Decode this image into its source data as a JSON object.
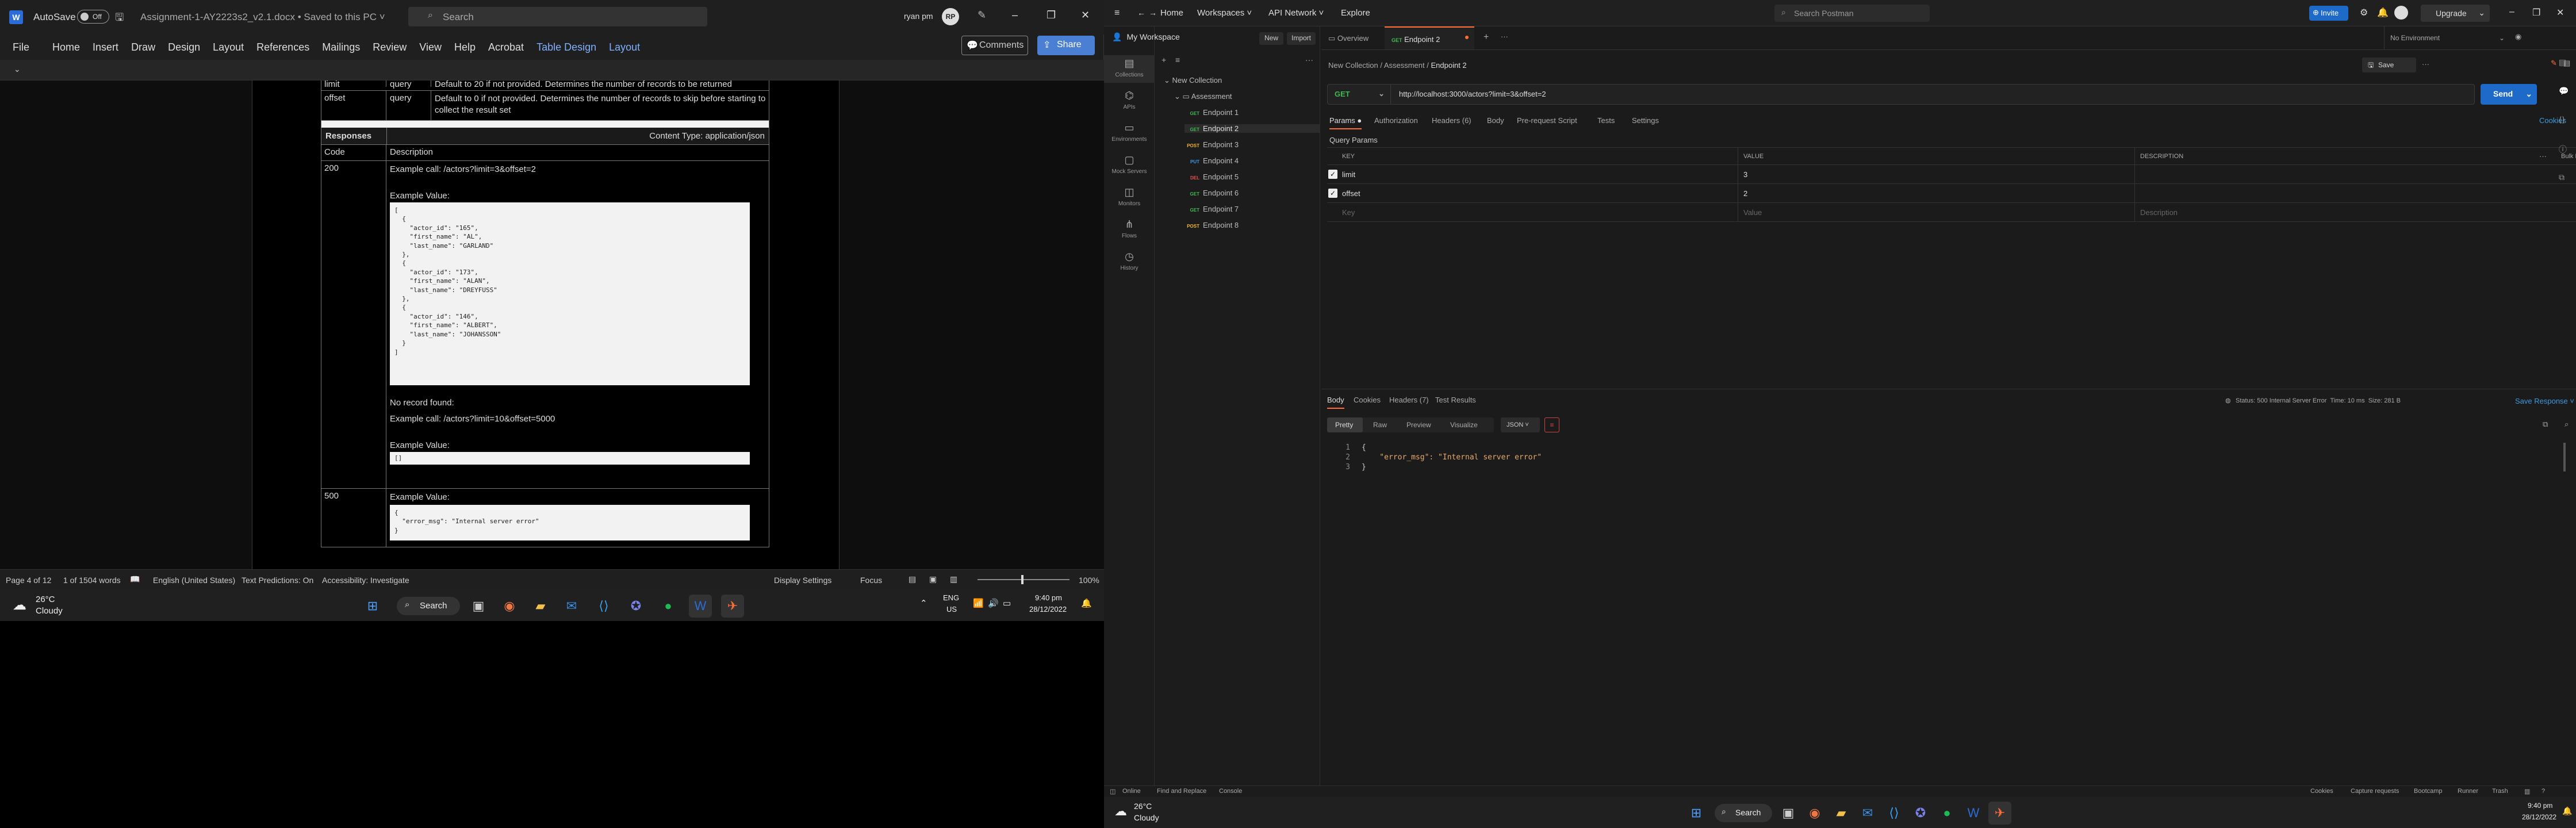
{
  "word": {
    "autosave": "AutoSave",
    "autosave_state": "Off",
    "doc_title": "Assignment-1-AY2223s2_v2.1.docx • Saved to this PC ˅",
    "search_placeholder": "Search",
    "user": "ryan pm",
    "avatar_initials": "RP",
    "menu": [
      "File",
      "Home",
      "Insert",
      "Draw",
      "Design",
      "Layout",
      "References",
      "Mailings",
      "Review",
      "View",
      "Help",
      "Acrobat",
      "Table Design",
      "Layout"
    ],
    "comments": "Comments",
    "share": "Share",
    "table": {
      "rows_top": [
        {
          "name": "limit",
          "type": "query",
          "desc": "Default to 20 if not provided. Determines the number of records to be returned"
        },
        {
          "name": "offset",
          "type": "query",
          "desc": "Default to 0 if not provided. Determines the number of records to skip before starting to collect the result set"
        }
      ],
      "responses_label": "Responses",
      "content_type": "Content Type: application/json",
      "col_code": "Code",
      "col_desc": "Description",
      "r200_code": "200",
      "r200_call": "Example call: /actors?limit=3&offset=2",
      "example_value": "Example Value:",
      "r200_json": "[\n  {\n    \"actor_id\": \"165\",\n    \"first_name\": \"AL\",\n    \"last_name\": \"GARLAND\"\n  },\n  {\n    \"actor_id\": \"173\",\n    \"first_name\": \"ALAN\",\n    \"last_name\": \"DREYFUSS\"\n  },\n  {\n    \"actor_id\": \"146\",\n    \"first_name\": \"ALBERT\",\n    \"last_name\": \"JOHANSSON\"\n  }\n]",
      "no_record": "No record found:",
      "r200_call2": "Example call: /actors?limit=10&offset=5000",
      "empty_json": "[]",
      "r500_code": "500",
      "r500_json": "{\n  \"error_msg\": \"Internal server error\"\n}"
    },
    "status": {
      "page": "Page 4 of 12",
      "words": "1 of 1504 words",
      "lang": "English (United States)",
      "predict": "Text Predictions: On",
      "access": "Accessibility: Investigate",
      "display": "Display Settings",
      "focus": "Focus",
      "zoom": "100%"
    },
    "taskbar": {
      "temp": "26°C",
      "weather": "Cloudy",
      "search": "Search",
      "lang1": "ENG",
      "lang2": "US",
      "time": "9:40 pm",
      "date": "28/12/2022"
    }
  },
  "postman": {
    "nav": [
      "Home",
      "Workspaces ˅",
      "API Network ˅",
      "Explore"
    ],
    "search": "Search Postman",
    "invite": "Invite",
    "upgrade": "Upgrade",
    "workspace": "My Workspace",
    "new_btn": "New",
    "import_btn": "Import",
    "rail": [
      "Collections",
      "APIs",
      "Environments",
      "Mock Servers",
      "Monitors",
      "Flows",
      "History"
    ],
    "collection": "New Collection",
    "folder": "Assessment",
    "endpoints": [
      {
        "m": "GET",
        "name": "Endpoint 1"
      },
      {
        "m": "GET",
        "name": "Endpoint 2"
      },
      {
        "m": "POST",
        "name": "Endpoint 3"
      },
      {
        "m": "PUT",
        "name": "Endpoint 4"
      },
      {
        "m": "DEL",
        "name": "Endpoint 5"
      },
      {
        "m": "GET",
        "name": "Endpoint 6"
      },
      {
        "m": "GET",
        "name": "Endpoint 7"
      },
      {
        "m": "POST",
        "name": "Endpoint 8"
      }
    ],
    "tab_overview": "Overview",
    "tab_active_method": "GET",
    "tab_active": "Endpoint 2",
    "no_env": "No Environment",
    "breadcrumb": [
      "New Collection",
      "Assessment",
      "Endpoint 2"
    ],
    "save": "Save",
    "method": "GET",
    "url": "http://localhost:3000/actors?limit=3&offset=2",
    "send": "Send",
    "req_tabs": [
      "Params ●",
      "Authorization",
      "Headers (6)",
      "Body",
      "Pre-request Script",
      "Tests",
      "Settings"
    ],
    "cookies": "Cookies",
    "query_params": "Query Params",
    "col_key": "KEY",
    "col_value": "VALUE",
    "col_desc": "DESCRIPTION",
    "bulk_edit": "Bulk Edit",
    "params": [
      {
        "key": "limit",
        "value": "3"
      },
      {
        "key": "offset",
        "value": "2"
      }
    ],
    "ph_key": "Key",
    "ph_value": "Value",
    "ph_desc": "Description",
    "resp_tabs": [
      "Body",
      "Cookies",
      "Headers (7)",
      "Test Results"
    ],
    "status_text": "Status: 500 Internal Server Error",
    "time_text": "Time: 10 ms",
    "size_text": "Size: 281 B",
    "save_response": "Save Response ˅",
    "view_tabs": [
      "Pretty",
      "Raw",
      "Preview",
      "Visualize"
    ],
    "format": "JSON ˅",
    "resp_lines": [
      "{",
      "    \"error_msg\": \"Internal server error\"",
      "}"
    ],
    "footer_left": [
      "Online",
      "Find and Replace",
      "Console"
    ],
    "footer_right": [
      "Cookies",
      "Capture requests",
      "Bootcamp",
      "Runner",
      "Trash"
    ],
    "taskbar": {
      "temp": "26°C",
      "weather": "Cloudy",
      "search": "Search",
      "time": "9:40 pm",
      "date": "28/12/2022"
    }
  }
}
